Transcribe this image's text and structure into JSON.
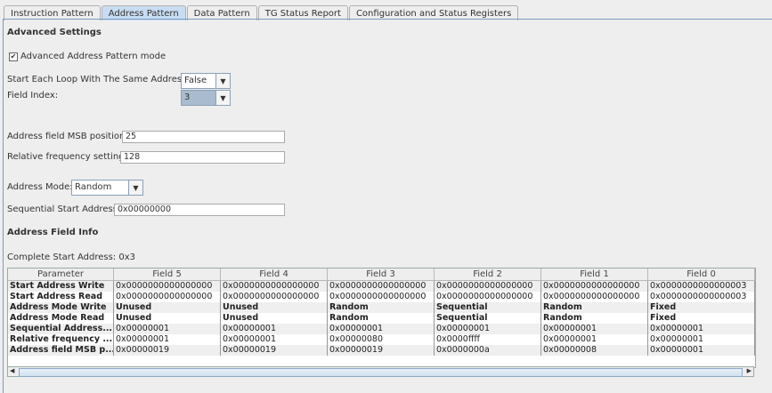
{
  "tabs": [
    "Instruction Pattern",
    "Address Pattern",
    "Data Pattern",
    "TG Status Report",
    "Configuration and Status Registers"
  ],
  "active_tab": "Address Pattern",
  "advanced_settings": {
    "title": "Advanced Settings",
    "checkbox_label": "Advanced Address Pattern mode",
    "checked": true,
    "start_each_loop_label": "Start Each Loop With The Same Address:",
    "start_each_loop_value": "False",
    "field_index_label": "Field Index:",
    "field_index_value": "3",
    "msb_label": "Address field MSB position:",
    "msb_value": "25",
    "freq_label": "Relative frequency setting:",
    "freq_value": "128",
    "mode_label": "Address Mode:",
    "mode_value": "Random",
    "seq_label": "Sequential Start Address:",
    "seq_value": "0x00000000"
  },
  "address_field_info": {
    "title": "Address Field Info",
    "complete_start": "Complete Start Address: 0x3"
  },
  "table": {
    "headers": [
      "Parameter",
      "Field 5",
      "Field 4",
      "Field 3",
      "Field 2",
      "Field 1",
      "Field 0"
    ],
    "rows": [
      [
        "Start Address Write",
        "0x0000000000000000",
        "0x0000000000000000",
        "0x0000000000000000",
        "0x0000000000000000",
        "0x0000000000000000",
        "0x0000000000000003"
      ],
      [
        "Start Address Read",
        "0x0000000000000000",
        "0x0000000000000000",
        "0x0000000000000000",
        "0x0000000000000000",
        "0x0000000000000000",
        "0x0000000000000003"
      ],
      [
        "Address Mode Write",
        "Unused",
        "Unused",
        "Random",
        "Sequential",
        "Random",
        "Fixed"
      ],
      [
        "Address Mode Read",
        "Unused",
        "Unused",
        "Random",
        "Sequential",
        "Random",
        "Fixed"
      ],
      [
        "Sequential Address...",
        "0x00000001",
        "0x00000001",
        "0x00000001",
        "0x00000001",
        "0x00000001",
        "0x00000001"
      ],
      [
        "Relative frequency ...",
        "0x00000001",
        "0x00000001",
        "0x00000080",
        "0x0000ffff",
        "0x00000001",
        "0x00000001"
      ],
      [
        "Address field MSB p...",
        "0x00000019",
        "0x00000019",
        "0x00000019",
        "0x0000000a",
        "0x00000008",
        "0x00000001"
      ]
    ]
  }
}
